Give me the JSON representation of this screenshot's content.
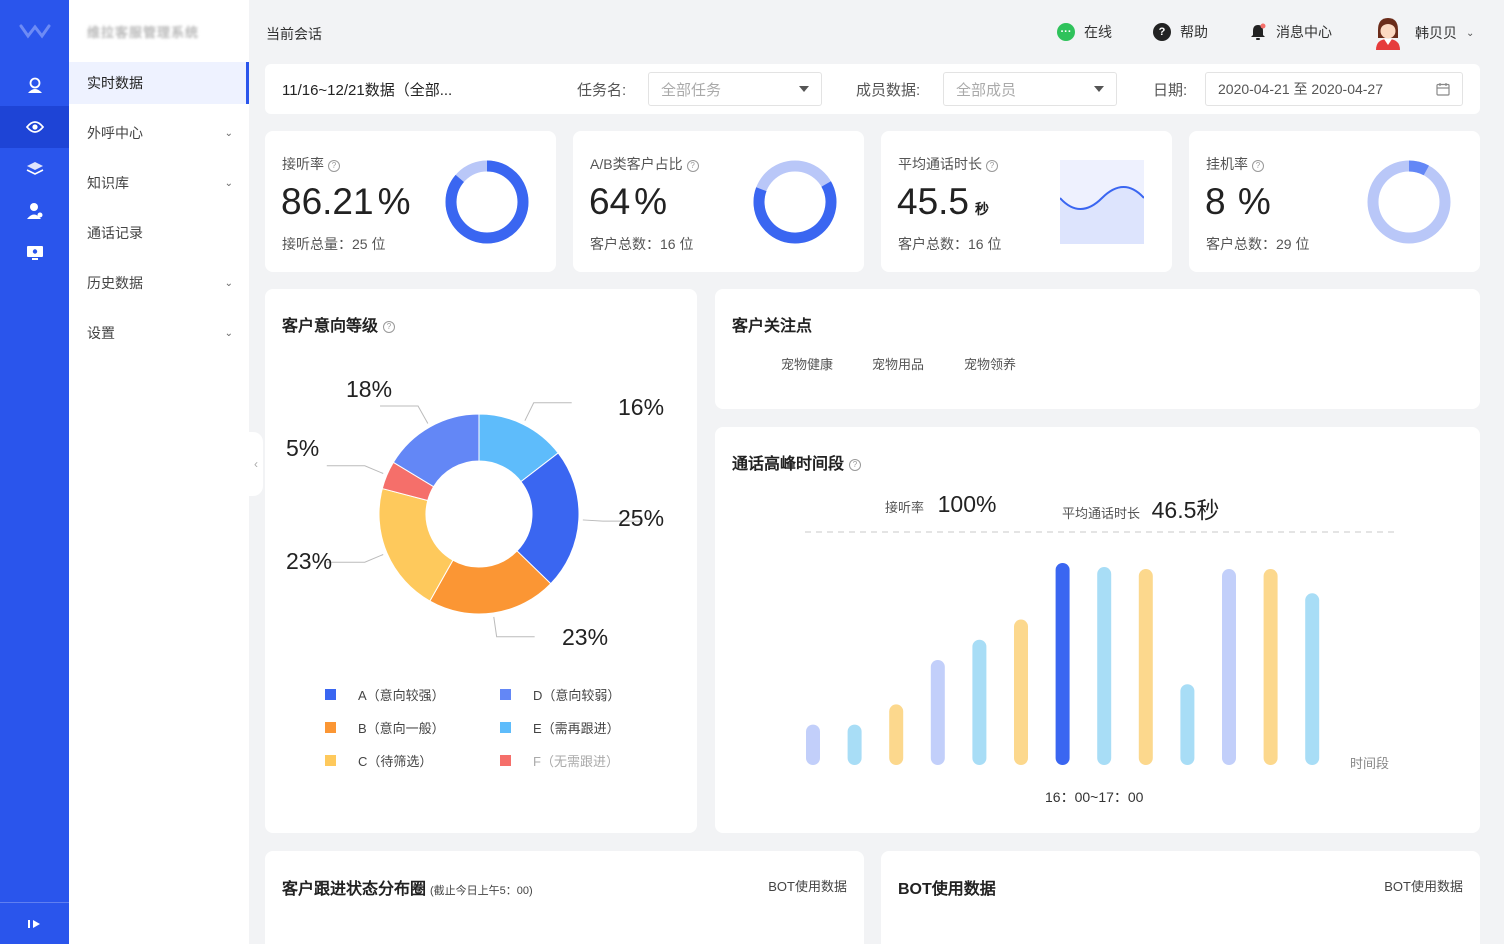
{
  "sidebar": {
    "brand": "维拉客服管理系统",
    "items": [
      {
        "label": "实时数据",
        "expandable": false,
        "active": true
      },
      {
        "label": "外呼中心",
        "expandable": true,
        "active": false
      },
      {
        "label": "知识库",
        "expandable": true,
        "active": false
      },
      {
        "label": "通话记录",
        "expandable": false,
        "active": false
      },
      {
        "label": "历史数据",
        "expandable": true,
        "active": false
      },
      {
        "label": "设置",
        "expandable": true,
        "active": false
      }
    ]
  },
  "topbar": {
    "breadcrumb": "当前会话",
    "status": "在线",
    "help": "帮助",
    "messages": "消息中心",
    "user": "韩贝贝"
  },
  "filter": {
    "range_title": "11/16~12/21数据（全部...",
    "task_label": "任务名:",
    "task_value": "全部任务",
    "member_label": "成员数据:",
    "member_value": "全部成员",
    "date_label": "日期:",
    "date_value": "2020-04-21 至 2020-04-27"
  },
  "kpis": [
    {
      "title": "接听率",
      "value": "86.21",
      "unit": "%",
      "sub": "接听总量：25 位",
      "fraction": 0.8621
    },
    {
      "title": "A/B类客户占比",
      "value": "64",
      "unit": "%",
      "sub": "客户总数：16 位",
      "fraction": 0.64
    },
    {
      "title": "平均通话时长",
      "value": "45.5",
      "unit": "秒",
      "sub": "客户总数：16 位"
    },
    {
      "title": "挂机率",
      "value": "8",
      "unit": " %",
      "sub": "客户总数：29 位",
      "fraction": 0.08
    }
  ],
  "intent": {
    "title": "客户意向等级",
    "chart_data": {
      "type": "pie",
      "slices": [
        {
          "label": "E（需再跟进）",
          "value": 16,
          "color": "#5ebcfb"
        },
        {
          "label": "A（意向较强）",
          "value": 25,
          "color": "#3a66f1"
        },
        {
          "label": "B（意向一般）",
          "value": 23,
          "color": "#fb9634"
        },
        {
          "label": "C（待筛选）",
          "value": 23,
          "color": "#fec95c"
        },
        {
          "label": "F（无需跟进）",
          "value": 5,
          "color": "#f56f6a"
        },
        {
          "label": "D（意向较弱）",
          "value": 18,
          "color": "#6387f6"
        }
      ]
    },
    "pct_labels": [
      "16%",
      "25%",
      "23%",
      "23%",
      "5%",
      "18%"
    ],
    "legend": [
      {
        "label": "A（意向较强）",
        "color": "#3a66f1",
        "muted": false
      },
      {
        "label": "D（意向较弱）",
        "color": "#6387f6",
        "muted": false
      },
      {
        "label": "B（意向一般）",
        "color": "#fb9634",
        "muted": false
      },
      {
        "label": "E（需再跟进）",
        "color": "#5ebcfb",
        "muted": false
      },
      {
        "label": "C（待筛选）",
        "color": "#fec95c",
        "muted": false
      },
      {
        "label": "F（无需跟进）",
        "color": "#f56f6a",
        "muted": true
      }
    ]
  },
  "focus": {
    "title": "客户关注点",
    "tags": [
      "宠物健康",
      "宠物用品",
      "宠物领养"
    ]
  },
  "peak": {
    "title": "通话高峰时间段",
    "rate_label": "接听率",
    "rate_value": "100%",
    "avg_label": "平均通话时长",
    "avg_value": "46.5秒",
    "x_axis_label": "时间段",
    "selected_label": "16：00~17：00",
    "chart_data": {
      "type": "bar",
      "values": [
        20,
        20,
        30,
        52,
        62,
        72,
        100,
        98,
        97,
        40,
        97,
        97,
        85
      ],
      "colors": [
        "#c2cffa",
        "#a8ddf6",
        "#fcd88d",
        "#c2cffa",
        "#a8ddf6",
        "#fcd88d",
        "#3a66f1",
        "#a8ddf6",
        "#fcd88d",
        "#a8ddf6",
        "#c2cffa",
        "#fcd88d",
        "#a8ddf6"
      ],
      "selected_index": 6
    }
  },
  "follow": {
    "title": "客户跟进状态分布圈",
    "note": "(截止今日上午5：00)",
    "link": "BOT使用数据"
  },
  "bot": {
    "title": "BOT使用数据",
    "link": "BOT使用数据"
  },
  "colors": {
    "primary": "#2a55ec",
    "online": "#2fc25b"
  }
}
